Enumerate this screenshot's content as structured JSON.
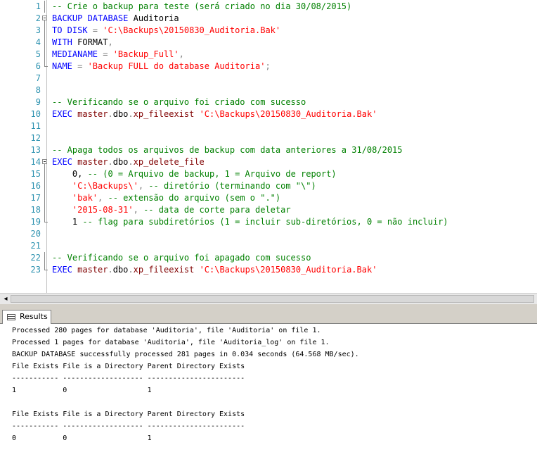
{
  "editor": {
    "lines": [
      {
        "n": "1",
        "fold": "vline",
        "tokens": [
          {
            "t": "-- Crie o backup para teste (será criado no dia 30/08/2015)",
            "c": "cm"
          }
        ]
      },
      {
        "n": "2",
        "fold": "box",
        "tokens": [
          {
            "t": "BACKUP DATABASE ",
            "c": "kw"
          },
          {
            "t": "Auditoria",
            "c": "tx"
          }
        ]
      },
      {
        "n": "3",
        "fold": "vline",
        "tokens": [
          {
            "t": "TO DISK ",
            "c": "kw"
          },
          {
            "t": "= ",
            "c": "gr"
          },
          {
            "t": "'C:\\Backups\\20150830_Auditoria.Bak'",
            "c": "str"
          }
        ]
      },
      {
        "n": "4",
        "fold": "vline",
        "tokens": [
          {
            "t": "WITH ",
            "c": "kw"
          },
          {
            "t": "FORMAT",
            "c": "tx"
          },
          {
            "t": ",",
            "c": "gr"
          }
        ]
      },
      {
        "n": "5",
        "fold": "vline",
        "tokens": [
          {
            "t": "MEDIANAME ",
            "c": "kw"
          },
          {
            "t": "= ",
            "c": "gr"
          },
          {
            "t": "'Backup_Full'",
            "c": "str"
          },
          {
            "t": ",",
            "c": "gr"
          }
        ]
      },
      {
        "n": "6",
        "fold": "end",
        "tokens": [
          {
            "t": "NAME ",
            "c": "kw"
          },
          {
            "t": "= ",
            "c": "gr"
          },
          {
            "t": "'Backup FULL do database Auditoria'",
            "c": "str"
          },
          {
            "t": ";",
            "c": "gr"
          }
        ]
      },
      {
        "n": "7",
        "fold": "none",
        "tokens": []
      },
      {
        "n": "8",
        "fold": "none",
        "tokens": []
      },
      {
        "n": "9",
        "fold": "none",
        "tokens": [
          {
            "t": "-- Verificando se o arquivo foi criado com sucesso",
            "c": "cm"
          }
        ]
      },
      {
        "n": "10",
        "fold": "none",
        "tokens": [
          {
            "t": "EXEC ",
            "c": "kw"
          },
          {
            "t": "master",
            "c": "fn"
          },
          {
            "t": ".",
            "c": "gr"
          },
          {
            "t": "dbo",
            "c": "tx"
          },
          {
            "t": ".",
            "c": "gr"
          },
          {
            "t": "xp_fileexist ",
            "c": "fn"
          },
          {
            "t": "'C:\\Backups\\20150830_Auditoria.Bak'",
            "c": "str"
          }
        ]
      },
      {
        "n": "11",
        "fold": "none",
        "tokens": []
      },
      {
        "n": "12",
        "fold": "none",
        "tokens": []
      },
      {
        "n": "13",
        "fold": "none",
        "tokens": [
          {
            "t": "-- Apaga todos os arquivos de backup com data anteriores a 31/08/2015",
            "c": "cm"
          }
        ]
      },
      {
        "n": "14",
        "fold": "box",
        "tokens": [
          {
            "t": "EXEC ",
            "c": "kw"
          },
          {
            "t": "master",
            "c": "fn"
          },
          {
            "t": ".",
            "c": "gr"
          },
          {
            "t": "dbo",
            "c": "tx"
          },
          {
            "t": ".",
            "c": "gr"
          },
          {
            "t": "xp_delete_file",
            "c": "fn"
          }
        ]
      },
      {
        "n": "15",
        "fold": "vline",
        "tokens": [
          {
            "t": "    0, ",
            "c": "tx"
          },
          {
            "t": "-- (0 = Arquivo de backup, 1 = Arquivo de report)",
            "c": "cm"
          }
        ]
      },
      {
        "n": "16",
        "fold": "vline",
        "tokens": [
          {
            "t": "    ",
            "c": "tx"
          },
          {
            "t": "'C:\\Backups\\'",
            "c": "str"
          },
          {
            "t": ", ",
            "c": "gr"
          },
          {
            "t": "-- diretório (terminando com \"\\\")",
            "c": "cm"
          }
        ]
      },
      {
        "n": "17",
        "fold": "vline",
        "tokens": [
          {
            "t": "    ",
            "c": "tx"
          },
          {
            "t": "'bak'",
            "c": "str"
          },
          {
            "t": ", ",
            "c": "gr"
          },
          {
            "t": "-- extensão do arquivo (sem o \".\")",
            "c": "cm"
          }
        ]
      },
      {
        "n": "18",
        "fold": "vline",
        "tokens": [
          {
            "t": "    ",
            "c": "tx"
          },
          {
            "t": "'2015-08-31'",
            "c": "str"
          },
          {
            "t": ", ",
            "c": "gr"
          },
          {
            "t": "-- data de corte para deletar",
            "c": "cm"
          }
        ]
      },
      {
        "n": "19",
        "fold": "end",
        "tokens": [
          {
            "t": "    1 ",
            "c": "tx"
          },
          {
            "t": "-- flag para subdiretórios (1 = incluir sub-diretórios, 0 = não incluir)",
            "c": "cm"
          }
        ]
      },
      {
        "n": "20",
        "fold": "none",
        "tokens": []
      },
      {
        "n": "21",
        "fold": "none",
        "tokens": []
      },
      {
        "n": "22",
        "fold": "vline",
        "tokens": [
          {
            "t": "-- Verificando se o arquivo foi apagado com sucesso",
            "c": "cm"
          }
        ]
      },
      {
        "n": "23",
        "fold": "end",
        "tokens": [
          {
            "t": "EXEC ",
            "c": "kw"
          },
          {
            "t": "master",
            "c": "fn"
          },
          {
            "t": ".",
            "c": "gr"
          },
          {
            "t": "dbo",
            "c": "tx"
          },
          {
            "t": ".",
            "c": "gr"
          },
          {
            "t": "xp_fileexist ",
            "c": "fn"
          },
          {
            "t": "'C:\\Backups\\20150830_Auditoria.Bak'",
            "c": "str"
          }
        ]
      }
    ]
  },
  "scrollbar": {
    "left_arrow": "◂"
  },
  "results_tab": {
    "label": "Results"
  },
  "results": {
    "lines": [
      "Processed 280 pages for database 'Auditoria', file 'Auditoria' on file 1.",
      "Processed 1 pages for database 'Auditoria', file 'Auditoria_log' on file 1.",
      "BACKUP DATABASE successfully processed 281 pages in 0.034 seconds (64.568 MB/sec).",
      "File Exists File is a Directory Parent Directory Exists",
      "----------- ------------------- -----------------------",
      "1           0                   1",
      "",
      "File Exists File is a Directory Parent Directory Exists",
      "----------- ------------------- -----------------------",
      "0           0                   1"
    ]
  },
  "colors": {
    "keyword": "#0000ff",
    "string": "#ff0000",
    "comment": "#008000",
    "line_number": "#2b91af",
    "function": "#800000"
  }
}
